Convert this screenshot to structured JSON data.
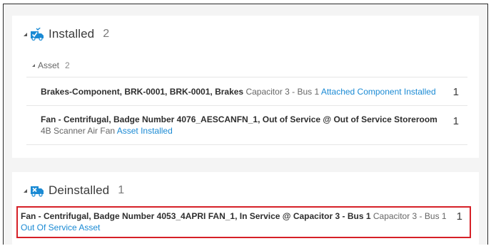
{
  "installed": {
    "title": "Installed",
    "count": "2",
    "icon": "truck-check-icon",
    "icon_color": "#1a8ad4",
    "group": {
      "label": "Asset",
      "count": "2"
    },
    "rows": [
      {
        "title": "Brakes-Component, BRK-0001, BRK-0001, Brakes",
        "sub": "Capacitor 3 - Bus 1",
        "link": "Attached Component Installed",
        "qty": "1"
      },
      {
        "title": "Fan - Centrifugal, Badge Number 4076_AESCANFN_1, Out of Service @ Out of Service Storeroom",
        "sub": "4B Scanner Air Fan",
        "link": "Asset Installed",
        "qty": "1"
      }
    ]
  },
  "deinstalled": {
    "title": "Deinstalled",
    "count": "1",
    "icon": "truck-remove-icon",
    "icon_color": "#1a8ad4",
    "rows": [
      {
        "title": "Fan - Centrifugal, Badge Number 4053_4APRI FAN_1, In Service @ Capacitor 3 - Bus 1",
        "sub": "Capacitor 3 - Bus 1",
        "link": "Out Of Service Asset",
        "qty": "1"
      }
    ]
  },
  "highlight_color": "#d62027",
  "link_color": "#1a8ad4"
}
